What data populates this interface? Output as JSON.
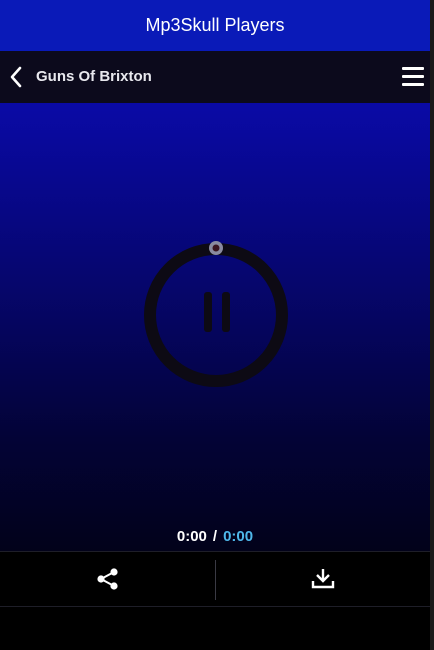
{
  "app_bar": {
    "title": "Mp3Skull Players"
  },
  "track_bar": {
    "title": "Guns Of Brixton",
    "back_icon": "chevron-left-icon",
    "menu_icon": "hamburger-menu-icon"
  },
  "player": {
    "state_icon": "pause-icon",
    "current_time": "0:00",
    "separator": "/",
    "total_time": "0:00",
    "progress": 0
  },
  "actions": {
    "share_icon": "share-icon",
    "download_icon": "download-icon"
  },
  "colors": {
    "app_bar": "#0a1ab8",
    "total_time": "#4fb8ea",
    "progress_knob": "#8a8aa0"
  }
}
